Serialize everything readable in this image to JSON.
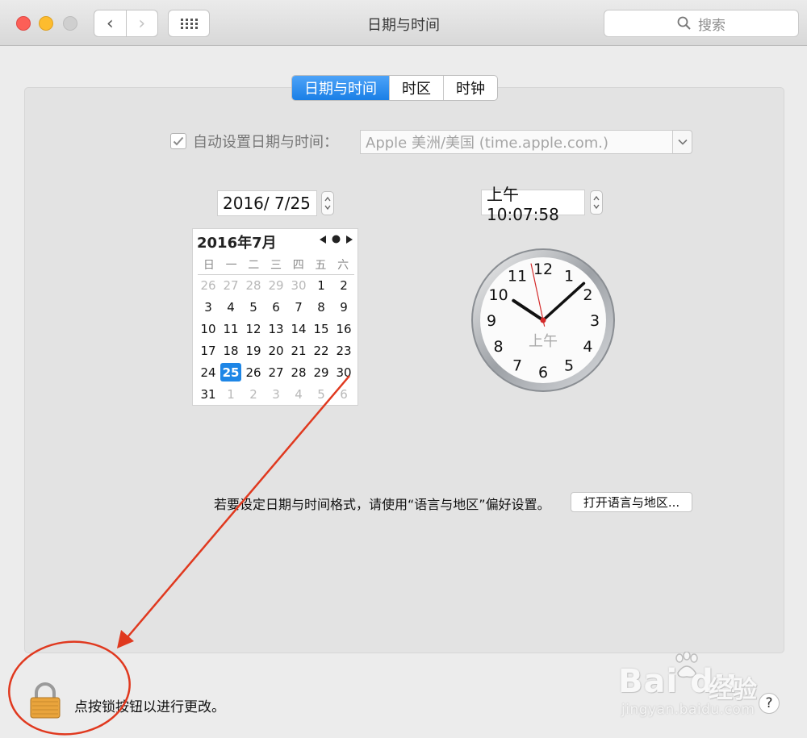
{
  "window": {
    "title": "日期与时间",
    "search_placeholder": "搜索",
    "back_glyph": "‹",
    "forward_glyph": "›"
  },
  "tabs": [
    {
      "label": "日期与时间",
      "active": true
    },
    {
      "label": "时区",
      "active": false
    },
    {
      "label": "时钟",
      "active": false
    }
  ],
  "auto_set": {
    "label": "自动设置日期与时间：",
    "checked": true,
    "server": "Apple 美洲/美国 (time.apple.com.)"
  },
  "date_field": "2016/  7/25",
  "time_field": "上午10:07:58",
  "calendar": {
    "title": "2016年7月",
    "weekdays": [
      "日",
      "一",
      "二",
      "三",
      "四",
      "五",
      "六"
    ],
    "days": [
      {
        "d": "26",
        "dim": true
      },
      {
        "d": "27",
        "dim": true
      },
      {
        "d": "28",
        "dim": true
      },
      {
        "d": "29",
        "dim": true
      },
      {
        "d": "30",
        "dim": true
      },
      {
        "d": "1"
      },
      {
        "d": "2"
      },
      {
        "d": "3"
      },
      {
        "d": "4"
      },
      {
        "d": "5"
      },
      {
        "d": "6"
      },
      {
        "d": "7"
      },
      {
        "d": "8"
      },
      {
        "d": "9"
      },
      {
        "d": "10"
      },
      {
        "d": "11"
      },
      {
        "d": "12"
      },
      {
        "d": "13"
      },
      {
        "d": "14"
      },
      {
        "d": "15"
      },
      {
        "d": "16"
      },
      {
        "d": "17"
      },
      {
        "d": "18"
      },
      {
        "d": "19"
      },
      {
        "d": "20"
      },
      {
        "d": "21"
      },
      {
        "d": "22"
      },
      {
        "d": "23"
      },
      {
        "d": "24"
      },
      {
        "d": "25",
        "selected": true
      },
      {
        "d": "26"
      },
      {
        "d": "27"
      },
      {
        "d": "28"
      },
      {
        "d": "29"
      },
      {
        "d": "30"
      },
      {
        "d": "31"
      },
      {
        "d": "1",
        "dim": true
      },
      {
        "d": "2",
        "dim": true
      },
      {
        "d": "3",
        "dim": true
      },
      {
        "d": "4",
        "dim": true
      },
      {
        "d": "5",
        "dim": true
      },
      {
        "d": "6",
        "dim": true
      }
    ]
  },
  "clock": {
    "numbers": [
      "12",
      "1",
      "2",
      "3",
      "4",
      "5",
      "6",
      "7",
      "8",
      "9",
      "10",
      "11"
    ],
    "ampm": "上午",
    "hour": 10,
    "minute": 7,
    "second": 58
  },
  "format_hint": "若要设定日期与时间格式，请使用“语言与地区”偏好设置。",
  "open_button": "打开语言与地区...",
  "lock_label": "点按锁按钮以进行更改。",
  "help_label": "?",
  "watermark": {
    "brand": "Bai du",
    "cn": "经验",
    "url": "jingyan.baidu.com"
  },
  "colors": {
    "accent": "#1e86e6",
    "annotation": "#e0391f"
  }
}
